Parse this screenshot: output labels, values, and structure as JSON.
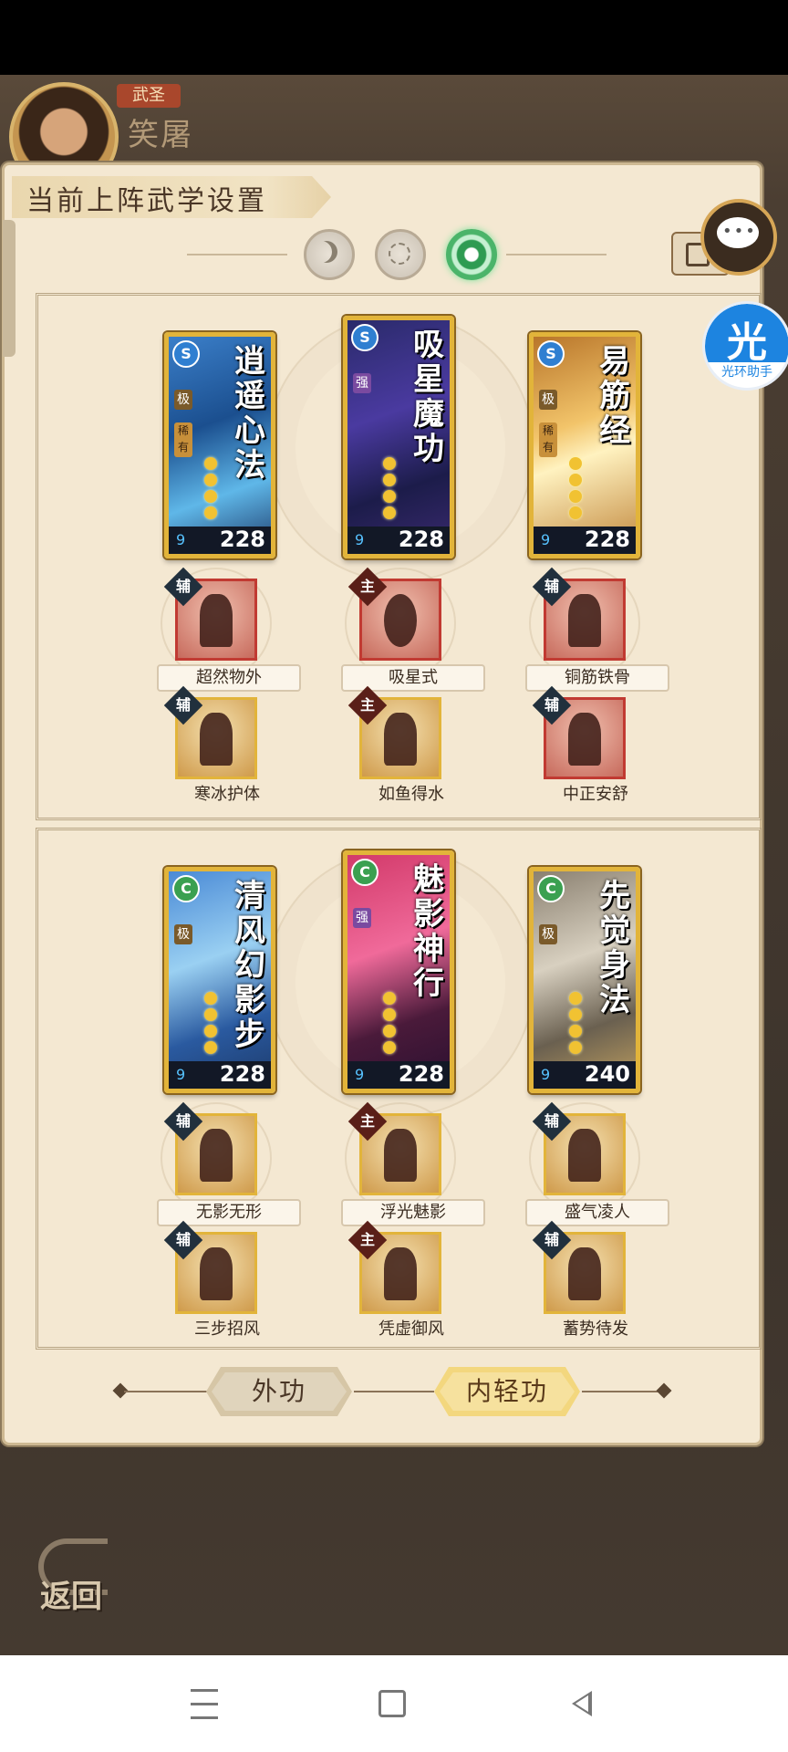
{
  "player": {
    "rank_badge": "武圣",
    "name": "笑屠"
  },
  "panel": {
    "title": "当前上阵武学设置"
  },
  "helper": {
    "mark": "光",
    "label": "光环助手"
  },
  "groups": [
    {
      "cards": [
        {
          "name": "逍遥心法",
          "element": "S",
          "element_color": "#2f7fd1",
          "rank": "极",
          "tag": "稀有",
          "level": "228"
        },
        {
          "name": "吸星魔功",
          "element": "S",
          "element_color": "#2f7fd1",
          "rank": "强",
          "tag": "",
          "level": "228"
        },
        {
          "name": "易筋经",
          "element": "S",
          "element_color": "#2f7fd1",
          "rank": "极",
          "tag": "稀有",
          "level": "228"
        }
      ],
      "skills_row1": [
        {
          "role": "辅",
          "label": "超然物外"
        },
        {
          "role": "主",
          "label": "吸星式"
        },
        {
          "role": "辅",
          "label": "铜筋铁骨"
        }
      ],
      "skills_row2": [
        {
          "role": "辅",
          "label": "寒冰护体"
        },
        {
          "role": "主",
          "label": "如鱼得水"
        },
        {
          "role": "辅",
          "label": "中正安舒"
        }
      ]
    },
    {
      "cards": [
        {
          "name": "清风幻影步",
          "element": "C",
          "element_color": "#3aa050",
          "rank": "极",
          "tag": "",
          "level": "228"
        },
        {
          "name": "魅影神行",
          "element": "C",
          "element_color": "#3aa050",
          "rank": "强",
          "tag": "",
          "level": "228"
        },
        {
          "name": "先觉身法",
          "element": "C",
          "element_color": "#3aa050",
          "rank": "极",
          "tag": "",
          "level": "240"
        }
      ],
      "skills_row1": [
        {
          "role": "辅",
          "label": "无影无形"
        },
        {
          "role": "主",
          "label": "浮光魅影"
        },
        {
          "role": "辅",
          "label": "盛气凌人"
        }
      ],
      "skills_row2": [
        {
          "role": "辅",
          "label": "三步招风"
        },
        {
          "role": "主",
          "label": "凭虚御风"
        },
        {
          "role": "辅",
          "label": "蓄势待发"
        }
      ]
    }
  ],
  "tabs": [
    {
      "label": "外功",
      "active": false
    },
    {
      "label": "内轻功",
      "active": true
    }
  ],
  "back_label": "返回",
  "colors": {
    "panel_bg": "#f4e8d2",
    "gold_frame": "#e2b43a",
    "active_mode": "#4bb46a",
    "helper_blue": "#1d84e0"
  }
}
